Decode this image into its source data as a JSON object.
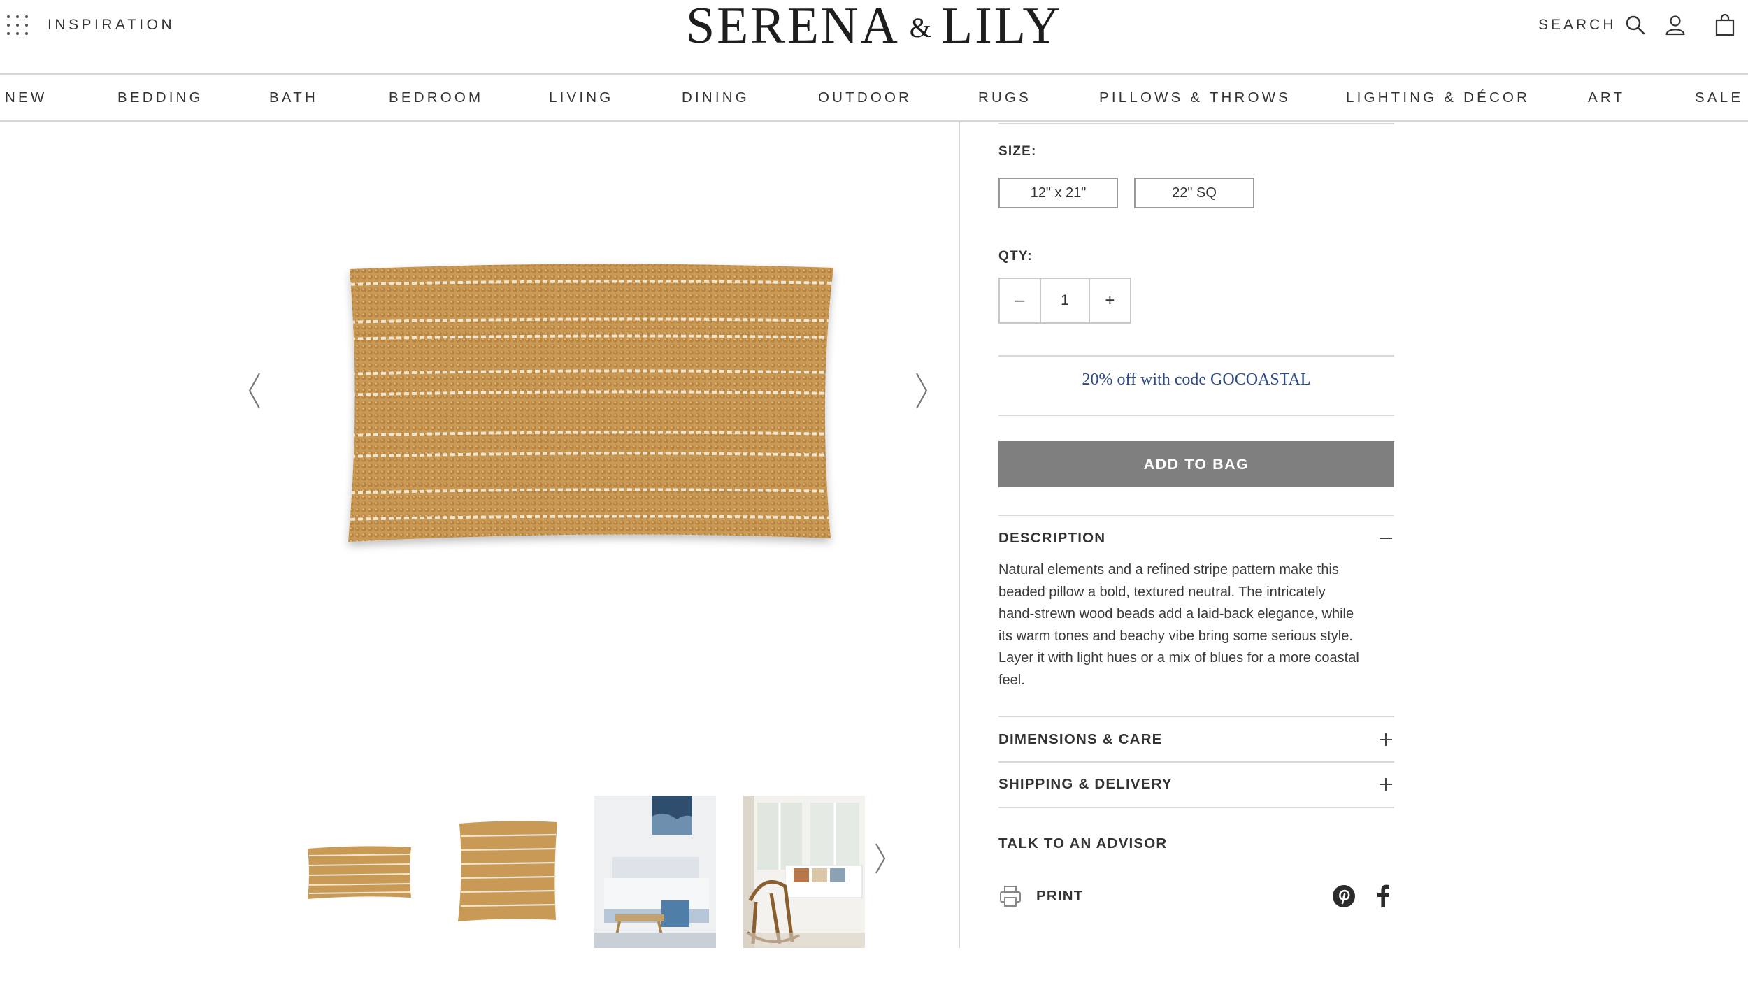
{
  "header": {
    "menu_label": "INSPIRATION",
    "logo_left": "SERENA",
    "logo_amp": "&",
    "logo_right": "LILY",
    "search_label": "SEARCH"
  },
  "nav": {
    "items": [
      "NEW",
      "BEDDING",
      "BATH",
      "BEDROOM",
      "LIVING",
      "DINING",
      "OUTDOOR",
      "RUGS",
      "PILLOWS & THROWS",
      "LIGHTING & DÉCOR",
      "ART",
      "SALE"
    ]
  },
  "gallery": {
    "main_image": "beaded-striped-lumbar-pillow",
    "thumbnails": [
      "lumbar-pillow-front",
      "square-pillow-front",
      "bedroom-scene-with-pillow",
      "living-room-scene-with-pillow"
    ]
  },
  "product": {
    "size_label": "SIZE:",
    "sizes": [
      "12\" x 21\"",
      "22\" SQ"
    ],
    "qty_label": "QTY:",
    "qty_minus": "–",
    "qty_value": "1",
    "qty_plus": "+",
    "promo": "20% off with code GOCOASTAL",
    "add_to_bag": "ADD TO BAG",
    "description_title": "DESCRIPTION",
    "description_lines": [
      "Natural elements and a refined stripe pattern make this",
      "beaded pillow a bold, textured neutral. The intricately",
      "hand-strewn wood beads add a laid-back elegance, while",
      "its warm tones and beachy vibe bring some serious style.",
      "Layer it with light hues or a mix of blues for a more coastal",
      "feel."
    ],
    "dimensions_title": "DIMENSIONS & CARE",
    "shipping_title": "SHIPPING & DELIVERY",
    "advisor": "TALK TO AN ADVISOR",
    "print": "PRINT"
  },
  "colors": {
    "promo_text": "#2d4a86",
    "add_to_bag_bg": "#7f7f7f",
    "pillow_base": "#c99a55",
    "stripe": "#efe6d2"
  }
}
